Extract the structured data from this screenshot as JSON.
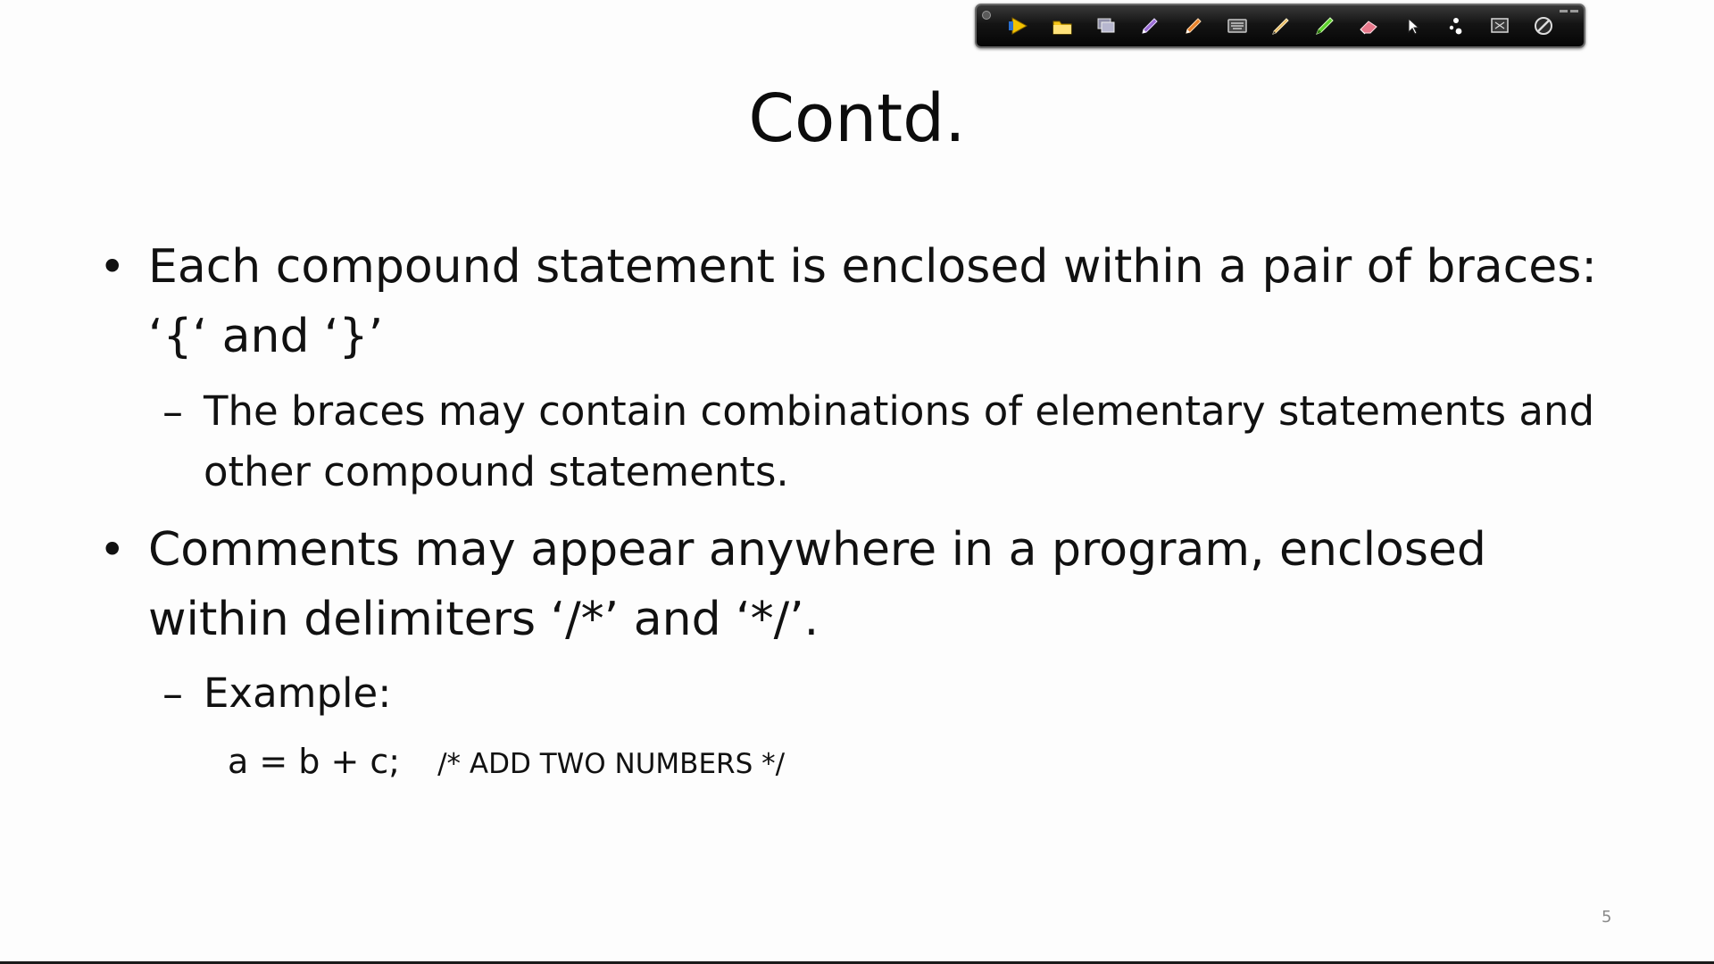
{
  "toolbar": {
    "tools": [
      {
        "name": "arrow-pointer-icon",
        "color": "#f2c200"
      },
      {
        "name": "folder-icon",
        "color": "#f5c518"
      },
      {
        "name": "slides-icon",
        "color": "#8f8fa8"
      },
      {
        "name": "pen-purple-icon",
        "color": "#9b6cd6"
      },
      {
        "name": "pen-orange-icon",
        "color": "#e8822a"
      },
      {
        "name": "keyboard-icon",
        "color": "#c9c9c9"
      },
      {
        "name": "pencil-icon",
        "color": "#e7b85d"
      },
      {
        "name": "highlighter-icon",
        "color": "#5ccf2b"
      },
      {
        "name": "eraser-icon",
        "color": "#e8798c"
      },
      {
        "name": "cursor-icon",
        "color": "#ffffff"
      },
      {
        "name": "laser-pointer-icon",
        "color": "#ffffff"
      },
      {
        "name": "whiteboard-icon",
        "color": "#d9d9d9"
      },
      {
        "name": "stop-icon",
        "color": "#dcdcdc"
      }
    ]
  },
  "slide": {
    "title": "Contd.",
    "bullet1": {
      "line1": "Each compound statement is enclosed within a pair of braces:",
      "line2": "‘{‘ and ‘}’",
      "sub": {
        "line1": "The braces may contain combinations of elementary statements and",
        "line2": "other compound statements."
      }
    },
    "bullet2": {
      "line1": "Comments may appear anywhere in a program, enclosed",
      "line2": "within delimiters ‘/*’ and ‘*/’.",
      "sub": {
        "label": "Example:"
      },
      "code": {
        "statement": "a = b + c;",
        "comment": "/* ADD TWO NUMBERS */"
      }
    },
    "bullet_symbol": "•",
    "dash_symbol": "–",
    "page_number": "5"
  }
}
